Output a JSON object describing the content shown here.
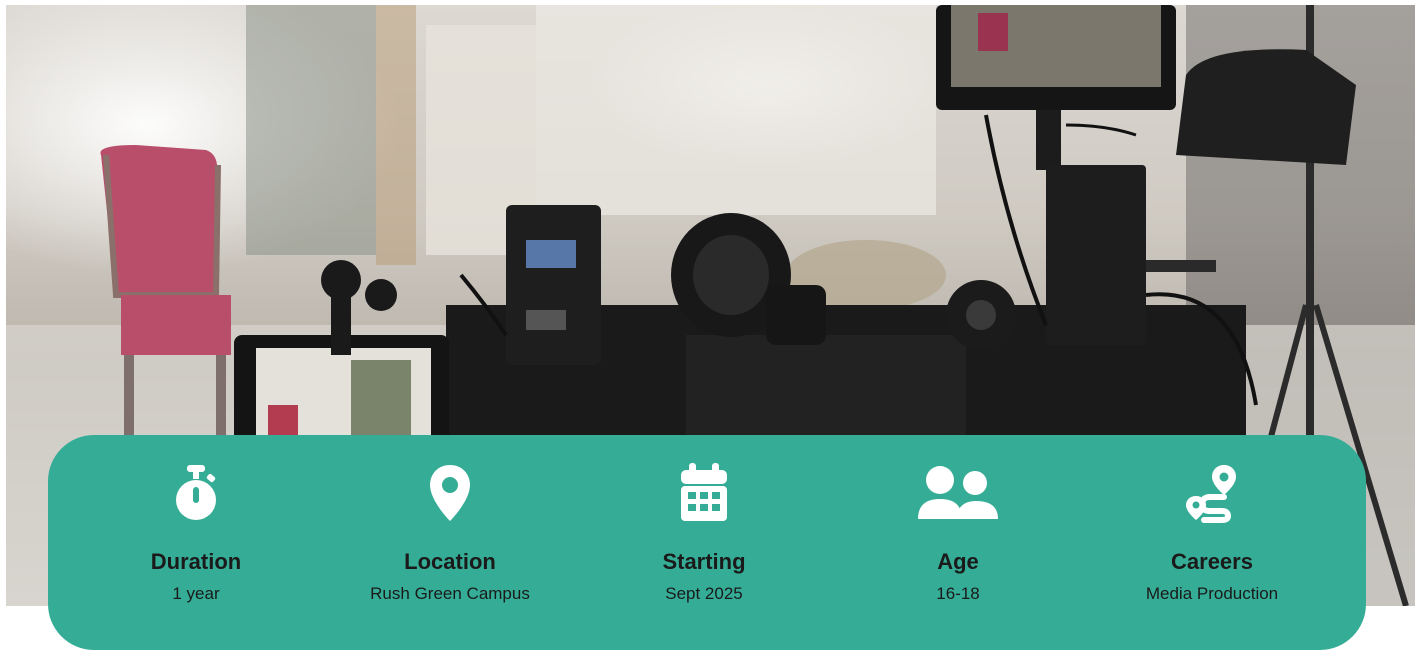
{
  "hero": {
    "scene": "film-camera-rig-photo"
  },
  "items": [
    {
      "label": "Duration",
      "value": "1 year",
      "icon": "stopwatch-icon"
    },
    {
      "label": "Location",
      "value": "Rush Green Campus",
      "icon": "map-pin-icon"
    },
    {
      "label": "Starting",
      "value": "Sept 2025",
      "icon": "calendar-icon"
    },
    {
      "label": "Age",
      "value": "16-18",
      "icon": "users-icon"
    },
    {
      "label": "Careers",
      "value": "Media Production",
      "icon": "route-icon"
    }
  ],
  "colors": {
    "panel": "#35ad96",
    "icon": "#ffffff",
    "text": "#1a1a1a"
  }
}
